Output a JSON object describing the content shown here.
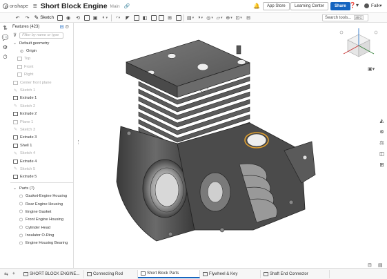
{
  "header": {
    "brand": "onshape",
    "title": "Short Block Engine",
    "workspace": "Main",
    "app_store": "App Store",
    "learning_center": "Learning Center",
    "share": "Share",
    "user": "Falk"
  },
  "toolbar": {
    "sketch_label": "Sketch",
    "search_placeholder": "Search tools...",
    "search_shortcut": "alt C"
  },
  "features": {
    "title": "Features (423)",
    "filter_placeholder": "Filter by name or type",
    "items": [
      {
        "label": "Default geometry",
        "dim": false
      },
      {
        "label": "Origin",
        "dim": false
      },
      {
        "label": "Top",
        "dim": true
      },
      {
        "label": "Front",
        "dim": true
      },
      {
        "label": "Right",
        "dim": true
      },
      {
        "label": "Center front plane",
        "dim": true
      },
      {
        "label": "Sketch 1",
        "dim": true
      },
      {
        "label": "Extrude 1",
        "dim": false
      },
      {
        "label": "Sketch 2",
        "dim": true
      },
      {
        "label": "Extrude 2",
        "dim": false
      },
      {
        "label": "Plane 1",
        "dim": true
      },
      {
        "label": "Sketch 3",
        "dim": true
      },
      {
        "label": "Extrude 3",
        "dim": false
      },
      {
        "label": "Shell 1",
        "dim": false
      },
      {
        "label": "Sketch 4",
        "dim": true
      },
      {
        "label": "Extrude 4",
        "dim": false
      },
      {
        "label": "Sketch 5",
        "dim": true
      },
      {
        "label": "Extrude 5",
        "dim": false
      }
    ]
  },
  "parts": {
    "title": "Parts (7)",
    "items": [
      "Gasket-Engine Housing",
      "Rear Engine Housing",
      "Engine Gasket",
      "Front Engine Housing",
      "Cylinder Head",
      "Insulator O-Ring",
      "Engine Housing Bearing"
    ]
  },
  "tabs": [
    {
      "label": "SHORT BLOCK ENGINE...",
      "active": false
    },
    {
      "label": "Connecting Rod",
      "active": false
    },
    {
      "label": "Short Block Parts",
      "active": true
    },
    {
      "label": "Flywheel & Key",
      "active": false
    },
    {
      "label": "Shaft End Connector",
      "active": false
    }
  ],
  "colors": {
    "accent": "#1565c0",
    "part_gray": "#5a5a5a",
    "highlight": "#e0a030"
  }
}
